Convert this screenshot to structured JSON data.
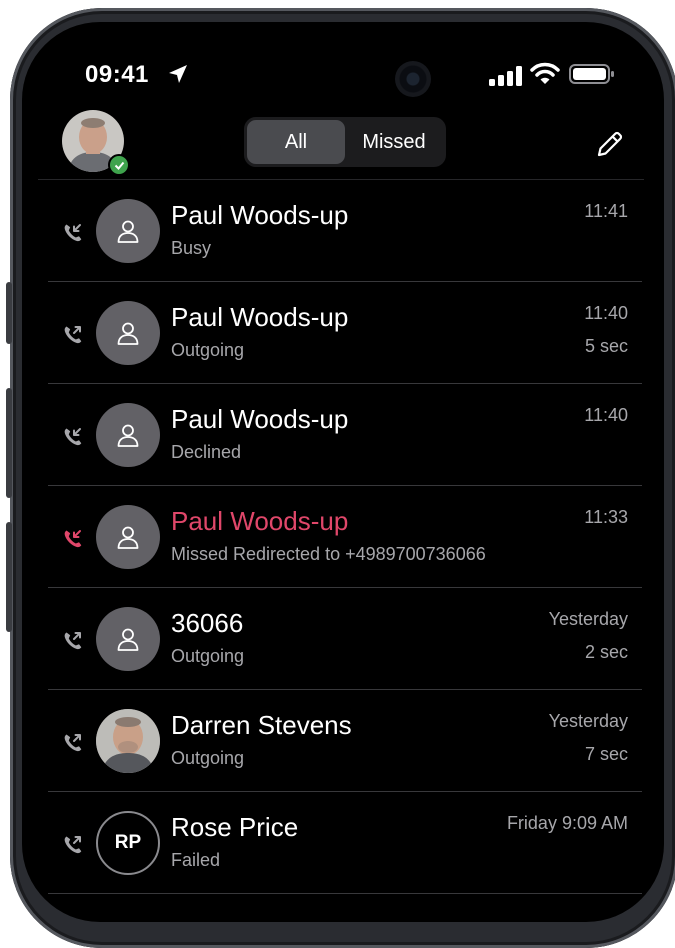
{
  "status_bar": {
    "time": "09:41"
  },
  "tabs": [
    {
      "label": "All",
      "active": true
    },
    {
      "label": "Missed",
      "active": false
    }
  ],
  "colors": {
    "missed": "#e0476a",
    "secondary": "#a7a7ab",
    "presence": "#3fa34d"
  },
  "calls": [
    {
      "name": "Paul Woods-up",
      "status": "Busy",
      "time": "11:41",
      "duration": "",
      "direction": "incoming",
      "missed": false,
      "avatar": "person-icon"
    },
    {
      "name": "Paul Woods-up",
      "status": "Outgoing",
      "time": "11:40",
      "duration": "5 sec",
      "direction": "outgoing",
      "missed": false,
      "avatar": "person-icon"
    },
    {
      "name": "Paul Woods-up",
      "status": "Declined",
      "time": "11:40",
      "duration": "",
      "direction": "incoming",
      "missed": false,
      "avatar": "person-icon"
    },
    {
      "name": "Paul Woods-up",
      "status": "Missed Redirected to +4989700736066",
      "time": "11:33",
      "duration": "",
      "direction": "incoming",
      "missed": true,
      "avatar": "person-icon"
    },
    {
      "name": "36066",
      "status": "Outgoing",
      "time": "Yesterday",
      "duration": "2 sec",
      "direction": "outgoing",
      "missed": false,
      "avatar": "person-icon"
    },
    {
      "name": "Darren Stevens",
      "status": "Outgoing",
      "time": "Yesterday",
      "duration": "7 sec",
      "direction": "outgoing",
      "missed": false,
      "avatar": "photo"
    },
    {
      "name": "Rose Price",
      "status": "Failed",
      "time": "Friday 9:09 AM",
      "duration": "",
      "direction": "outgoing",
      "missed": false,
      "avatar": "initials",
      "initials": "RP"
    }
  ]
}
